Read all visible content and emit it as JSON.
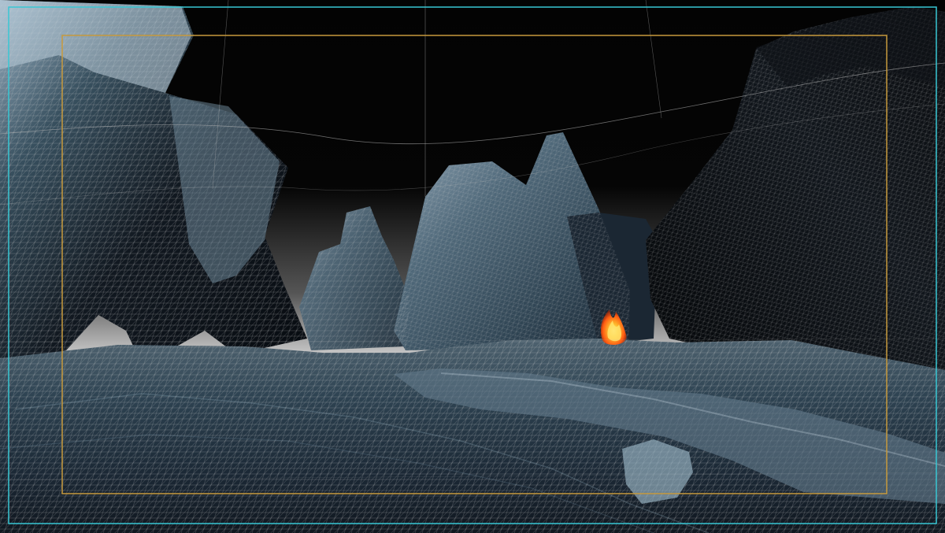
{
  "viewport": {
    "mode": "wireframe-on-shaded",
    "scene_objects": [
      "sky-backdrop",
      "left-cliff",
      "right-cliff",
      "center-rock-spires",
      "ground-terrain",
      "flame-effect"
    ],
    "overlay_guides": [
      "outer-frame-guide",
      "safe-area-guide",
      "wireframe-mesh"
    ]
  },
  "theme": {
    "background": "#000000",
    "sky_top": "#050505",
    "sky_horizon": "#cfcfcf",
    "rock_dark": "#1b2733",
    "rock_mid": "#4b6474",
    "rock_light": "#a8bccb",
    "wire": "#b8b8b8",
    "outer_frame": "#38c7d4",
    "safe_area": "#c79a3d",
    "fire_core": "#ffb12a",
    "fire_outer": "#ff4d12"
  }
}
